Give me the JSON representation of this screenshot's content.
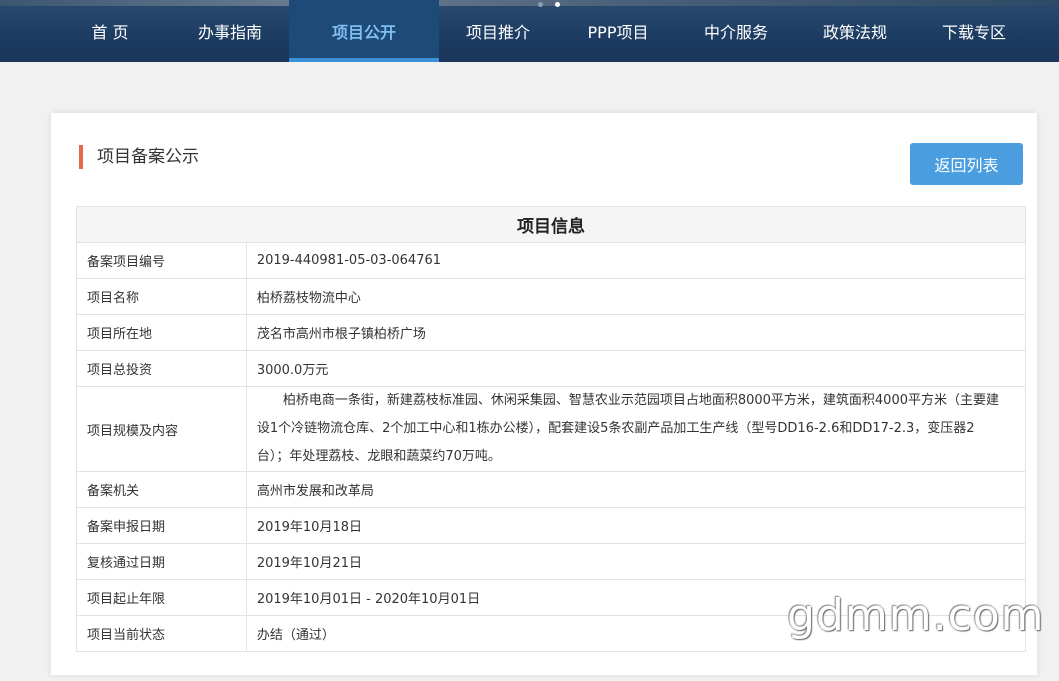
{
  "nav": {
    "items": [
      {
        "label": "首 页",
        "active": false
      },
      {
        "label": "办事指南",
        "active": false
      },
      {
        "label": "项目公开",
        "active": true
      },
      {
        "label": "项目推介",
        "active": false
      },
      {
        "label": "PPP项目",
        "active": false
      },
      {
        "label": "中介服务",
        "active": false
      },
      {
        "label": "政策法规",
        "active": false
      },
      {
        "label": "下载专区",
        "active": false
      }
    ]
  },
  "panel": {
    "section_title": "项目备案公示",
    "back_button": "返回列表"
  },
  "table": {
    "header": "项目信息",
    "rows": [
      {
        "label": "备案项目编号",
        "value": "2019-440981-05-03-064761"
      },
      {
        "label": "项目名称",
        "value": "柏桥荔枝物流中心"
      },
      {
        "label": "项目所在地",
        "value": "茂名市高州市根子镇柏桥广场"
      },
      {
        "label": "项目总投资",
        "value": "3000.0万元"
      },
      {
        "label": "项目规模及内容",
        "value": "柏桥电商一条街，新建荔枝标准园、休闲采集园、智慧农业示范园项目占地面积8000平方米，建筑面积4000平方米（主要建设1个冷链物流仓库、2个加工中心和1栋办公楼），配套建设5条农副产品加工生产线（型号DD16-2.6和DD17-2.3，变压器2台）；年处理荔枝、龙眼和蔬菜约70万吨。"
      },
      {
        "label": "备案机关",
        "value": "高州市发展和改革局"
      },
      {
        "label": "备案申报日期",
        "value": "2019年10月18日"
      },
      {
        "label": "复核通过日期",
        "value": "2019年10月21日"
      },
      {
        "label": "项目起止年限",
        "value": "2019年10月01日 - 2020年10月01日"
      },
      {
        "label": "项目当前状态",
        "value": "办结（通过）"
      }
    ]
  },
  "watermark": "gdmm.com"
}
